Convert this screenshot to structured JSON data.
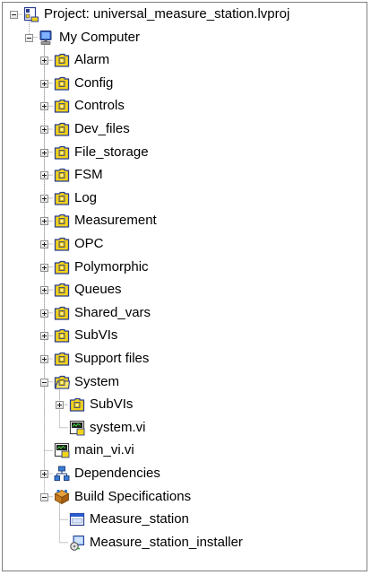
{
  "project": {
    "label": "Project: universal_measure_station.lvproj",
    "computer": {
      "label": "My Computer",
      "folders": [
        {
          "label": "Alarm"
        },
        {
          "label": "Config"
        },
        {
          "label": "Controls"
        },
        {
          "label": "Dev_files"
        },
        {
          "label": "File_storage"
        },
        {
          "label": "FSM"
        },
        {
          "label": "Log"
        },
        {
          "label": "Measurement"
        },
        {
          "label": "OPC"
        },
        {
          "label": "Polymorphic"
        },
        {
          "label": "Queues"
        },
        {
          "label": "Shared_vars"
        },
        {
          "label": "SubVIs"
        },
        {
          "label": "Support files"
        }
      ],
      "system": {
        "label": "System",
        "subvis": {
          "label": "SubVIs"
        },
        "system_vi": {
          "label": "system.vi"
        }
      },
      "main_vi": {
        "label": "main_vi.vi"
      },
      "dependencies": {
        "label": "Dependencies"
      },
      "build_specs": {
        "label": "Build Specifications",
        "items": [
          {
            "label": "Measure_station",
            "icon": "application-icon"
          },
          {
            "label": "Measure_station_installer",
            "icon": "installer-icon"
          }
        ]
      }
    }
  },
  "colors": {
    "tree_line": "#a0a0a0",
    "folder_fill": "#f2d21a",
    "folder_edge": "#2a3d8f",
    "panel_border": "#7f7f7f"
  }
}
